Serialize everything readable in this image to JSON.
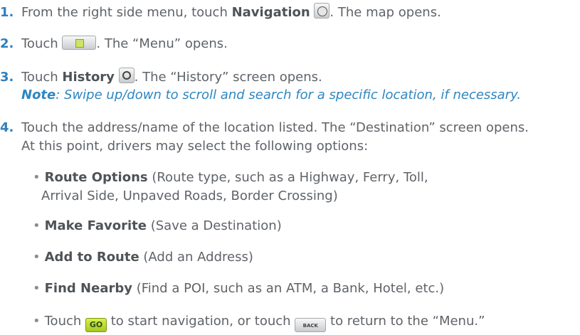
{
  "steps": [
    {
      "num": "1.",
      "a": "From the right side menu, touch ",
      "b": "Navigation",
      "c": ". The map opens."
    },
    {
      "num": "2.",
      "a": "Touch ",
      "c": ". The “Menu” opens."
    },
    {
      "num": "3.",
      "a": "Touch ",
      "b": "History",
      "c": ". The “History” screen opens."
    },
    {
      "num": "4.",
      "a": "Touch the address/name of the location listed. The “Destination” screen opens."
    }
  ],
  "note": {
    "label": "Note",
    "text": ": Swipe up/down to scroll and search for a specific location, if necessary."
  },
  "step4_cont": "At this point, drivers may select the following options:",
  "options": [
    {
      "b": "Route Options",
      "t": " (Route type, such as a Highway, Ferry, Toll,",
      "t2": "Arrival Side, Unpaved Roads, Border Crossing)"
    },
    {
      "b": "Make Favorite",
      "t": " (Save a Destination)"
    },
    {
      "b": "Add to Route",
      "t": " (Add an Address)"
    },
    {
      "b": "Find Nearby",
      "t": " (Find a POI, such as an ATM, a Bank, Hotel, etc.)"
    }
  ],
  "last": {
    "a": "Touch ",
    "b": " to start navigation, or touch ",
    "c": " to return to the “Menu.”"
  },
  "icons": {
    "go_label": "GO",
    "back_label": "BACK"
  }
}
